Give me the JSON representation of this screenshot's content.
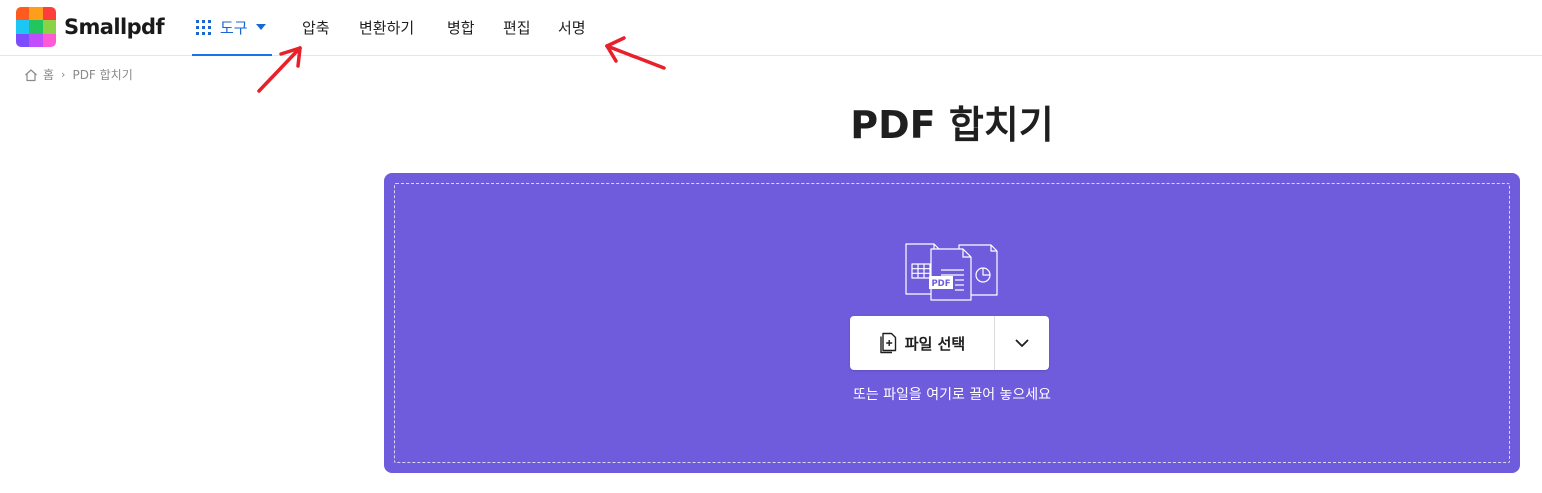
{
  "app": {
    "brand": "Smallpdf"
  },
  "logo": {
    "tile_colors": [
      "#ff5a1f",
      "#ff9e1b",
      "#ff3d3d",
      "#1cc7f4",
      "#22c55e",
      "#8bd346",
      "#7c4dff",
      "#c24dff",
      "#ff5ad6"
    ]
  },
  "nav": {
    "tools_label": "도구",
    "links": [
      "압축",
      "변환하기",
      "병합",
      "편집",
      "서명"
    ]
  },
  "breadcrumb": {
    "home": "홈",
    "current": "PDF 합치기"
  },
  "page": {
    "title": "PDF 합치기"
  },
  "upload": {
    "illustration_label": "PDF",
    "select_label": "파일 선택",
    "drop_hint": "또는 파일을 여기로 끌어 놓으세요"
  },
  "colors": {
    "accent": "#1a66d2",
    "dropzone": "#6f5cdc",
    "annotation": "#e8202a"
  }
}
